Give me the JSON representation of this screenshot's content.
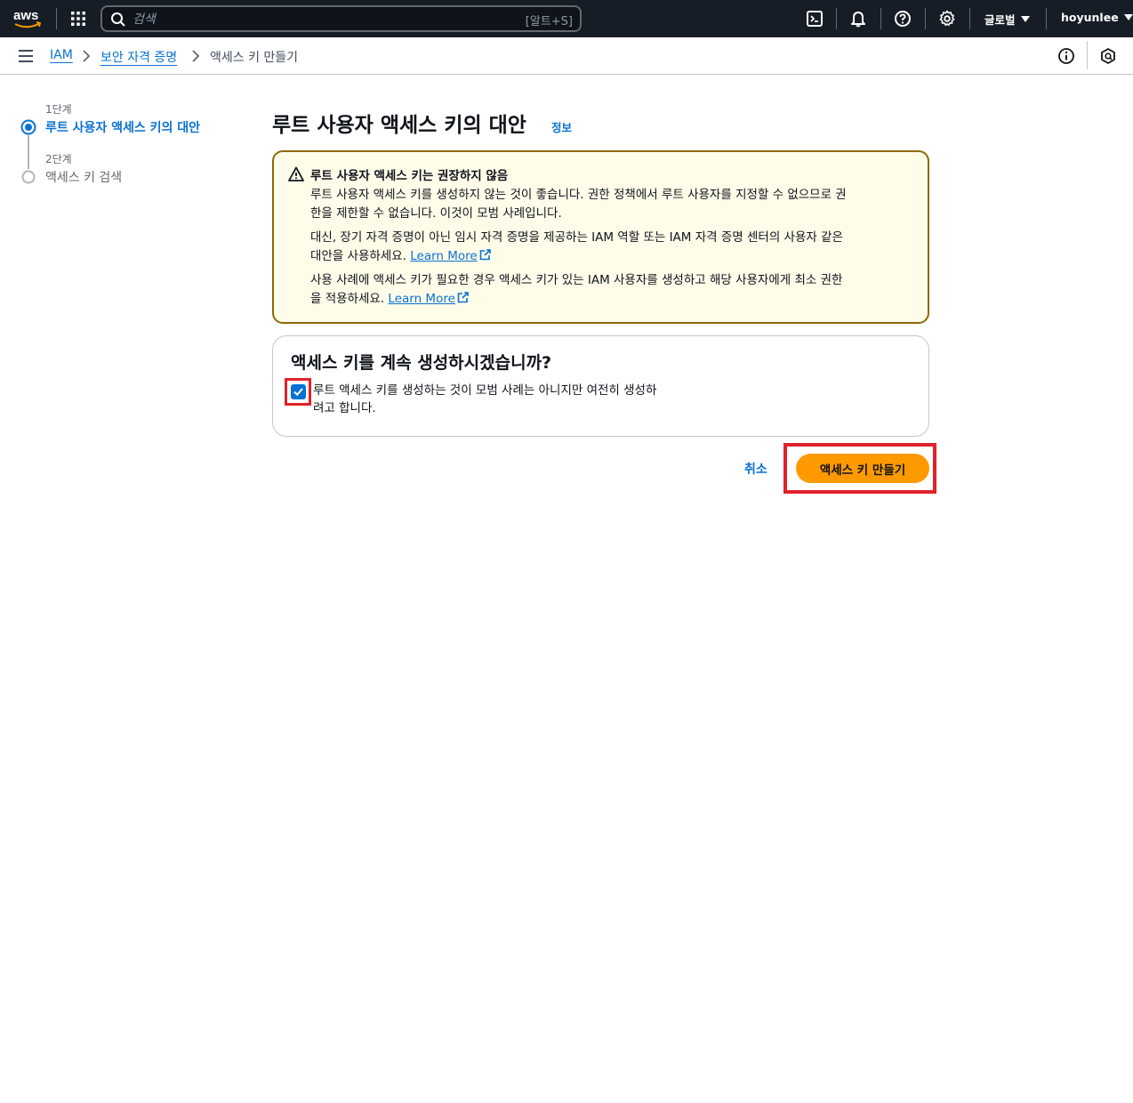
{
  "topnav": {
    "logo_text": "aws",
    "search_placeholder": "검색",
    "search_shortcut": "[알트+S]",
    "region_label": "글로벌",
    "user_label": "hoyunlee",
    "icons": [
      "apps-grid-icon",
      "search-icon",
      "cloudshell-icon",
      "bell-icon",
      "help-icon",
      "gear-icon"
    ]
  },
  "breadcrumb": {
    "items": [
      "IAM",
      "보안 자격 증명",
      "액세스 키 만들기"
    ]
  },
  "steps": [
    {
      "num": "1단계",
      "label": "루트 사용자 액세스 키의 대안",
      "active": true
    },
    {
      "num": "2단계",
      "label": "액세스 키 검색",
      "active": false
    }
  ],
  "main": {
    "title": "루트 사용자 액세스 키의 대안",
    "info_link": "정보",
    "warning": {
      "title": "루트 사용자 액세스 키는 권장하지 않음",
      "p1_line1": "루트 사용자 액세스 키를 생성하지 않는 것이 좋습니다. 권한 정책에서 루트 사용자를 지정할 수 없으므로 권",
      "p1_line2": "한을 제한할 수 없습니다. 이것이 모범 사례입니다.",
      "p2_line1": "대신, 장기 자격 증명이 아닌 임시 자격 증명을 제공하는 IAM 역할 또는 IAM 자격 증명 센터의 사용자 같은",
      "p2_line2": "대안을 사용하세요.",
      "p3_line1": "사용 사례에 액세스 키가 필요한 경우 액세스 키가 있는 IAM 사용자를 생성하고 해당 사용자에게 최소 권한",
      "p3_line2": "을 적용하세요.",
      "learn_more": "Learn More"
    },
    "confirm": {
      "title": "액세스 키를 계속 생성하시겠습니까?",
      "checkbox_line1": "루트 액세스 키를 생성하는 것이 모범 사례는 아니지만 여전히 생성하",
      "checkbox_line2": "려고 합니다.",
      "checked": true
    },
    "actions": {
      "cancel": "취소",
      "create": "액세스 키 만들기"
    }
  },
  "colors": {
    "nav_bg": "#161d26",
    "link": "#0972d3",
    "primary": "#ff9900",
    "warning_bg": "#fffce9",
    "warning_border": "#906806",
    "highlight": "#e0222b"
  }
}
